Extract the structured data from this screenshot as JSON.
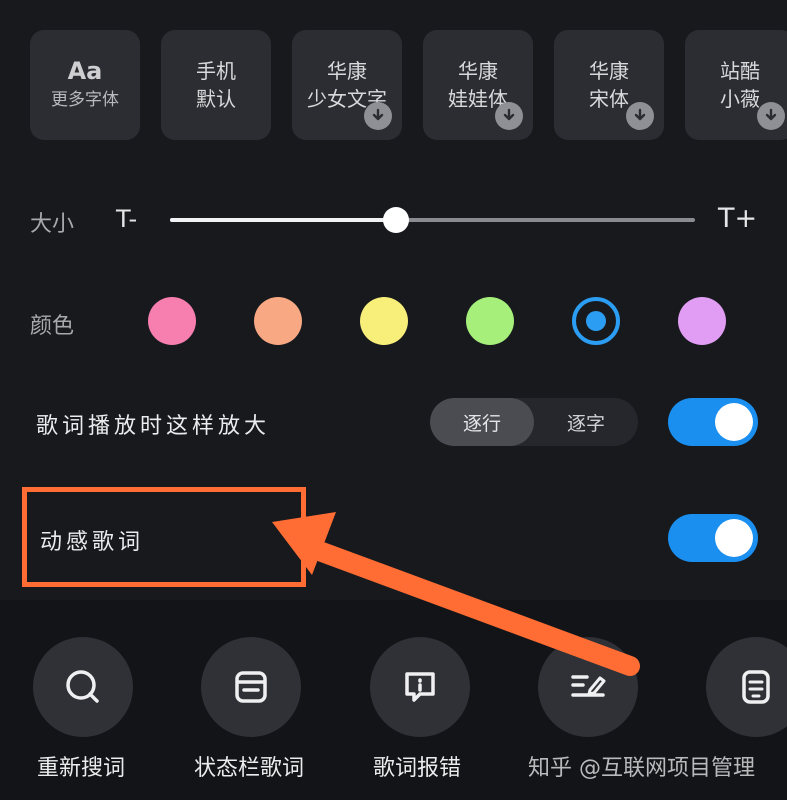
{
  "fonts": [
    {
      "line1": "Aa",
      "line2": "更多字体",
      "download": false
    },
    {
      "line1": "手机",
      "line2": "默认",
      "download": false
    },
    {
      "line1": "华康",
      "line2": "少女文字",
      "download": true
    },
    {
      "line1": "华康",
      "line2": "娃娃体",
      "download": true
    },
    {
      "line1": "华康",
      "line2": "宋体",
      "download": true
    },
    {
      "line1": "站酷",
      "line2": "小薇",
      "download": true
    }
  ],
  "size": {
    "label": "大小",
    "minus": "T-",
    "plus": "T+",
    "value_fraction": 0.43
  },
  "color": {
    "label": "颜色",
    "swatches": [
      "#f77fb0",
      "#f8a882",
      "#f8ee7a",
      "#a5ef7a",
      "#2b9df2",
      "#e19cf4"
    ],
    "selected_index": 4
  },
  "enlarge": {
    "label": "歌词播放时这样放大",
    "options": [
      "逐行",
      "逐字"
    ],
    "selected": "逐行",
    "toggle_on": true
  },
  "dynamic": {
    "label": "动感歌词",
    "toggle_on": true
  },
  "actions": [
    {
      "label": "重新搜词",
      "icon": "search-icon"
    },
    {
      "label": "状态栏歌词",
      "icon": "status-bar-lyrics-icon"
    },
    {
      "label": "歌词报错",
      "icon": "report-error-icon"
    },
    {
      "label": "",
      "icon": "edit-lyrics-icon"
    },
    {
      "label": "",
      "icon": "lyrics-doc-icon"
    }
  ],
  "watermark": "知乎 @互联网项目管理",
  "accent_color": "#1a8ff0",
  "annotation_color": "#ff6d34"
}
